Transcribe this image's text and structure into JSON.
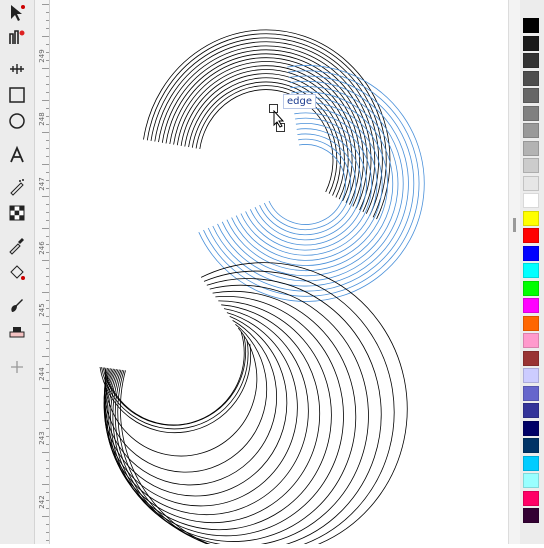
{
  "toolbox": {
    "tools": [
      {
        "name": "node-tool",
        "icon": "node-arrow-icon"
      },
      {
        "name": "tweak-tool",
        "icon": "tweak-icon"
      },
      {
        "name": "zoom-tool",
        "icon": "measure-icon"
      },
      {
        "name": "rect-tool",
        "icon": "rectangle-icon"
      },
      {
        "name": "ellipse-tool",
        "icon": "circle-icon"
      },
      {
        "name": "text-tool",
        "icon": "text-A-icon"
      },
      {
        "name": "spray-tool",
        "icon": "spray-icon"
      },
      {
        "name": "mesh-tool",
        "icon": "mesh-checker-icon"
      },
      {
        "name": "dropper-tool",
        "icon": "dropper-icon"
      },
      {
        "name": "paint-bucket-tool",
        "icon": "bucket-icon"
      },
      {
        "name": "calligraphy-tool",
        "icon": "brush-icon"
      },
      {
        "name": "eraser-tool",
        "icon": "eraser-icon"
      },
      {
        "name": "add-tool",
        "icon": "plus-icon"
      }
    ]
  },
  "ruler": {
    "labels": [
      "249",
      "248",
      "247",
      "246",
      "245",
      "244",
      "243",
      "242"
    ]
  },
  "tooltip": {
    "text": "edge"
  },
  "palette": {
    "colors": [
      "#000000",
      "#1a1a1a",
      "#333333",
      "#4d4d4d",
      "#666666",
      "#808080",
      "#999999",
      "#b3b3b3",
      "#cccccc",
      "#e6e6e6",
      "#ffffff",
      "#ffff00",
      "#ff0000",
      "#0000ff",
      "#00ffff",
      "#00ff00",
      "#ff00ff",
      "#ff6600",
      "#ff99cc",
      "#993333",
      "#ccccff",
      "#6666cc",
      "#333399",
      "#000066",
      "#003366",
      "#00ccff",
      "#99ffff",
      "#ff0066",
      "#330033"
    ]
  },
  "colors": {
    "accent": "#4a90d9",
    "stroke": "#000000"
  }
}
